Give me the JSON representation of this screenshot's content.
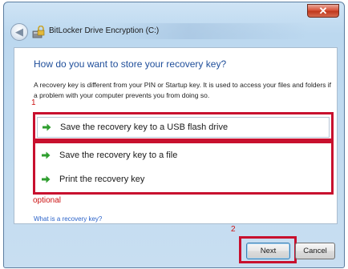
{
  "window": {
    "title": "BitLocker Drive Encryption (C:)",
    "close_glyph": "✕",
    "back_glyph": "◀"
  },
  "page": {
    "heading": "How do you want to store your recovery key?",
    "description": "A recovery key is different from your PIN or Startup key. It is used to access your files and folders if a problem with your computer prevents you from doing so."
  },
  "options": [
    {
      "icon": "green-arrow-icon",
      "label": "Save the recovery key to a USB flash drive"
    },
    {
      "icon": "green-arrow-icon",
      "label": "Save the recovery key to a file"
    },
    {
      "icon": "green-arrow-icon",
      "label": "Print the recovery key"
    }
  ],
  "help_link": "What is a recovery key?",
  "annotations": {
    "marker_1": "1",
    "marker_2": "2",
    "optional_label": "optional",
    "color": "#c8102e"
  },
  "buttons": {
    "next": "Next",
    "cancel": "Cancel"
  },
  "colors": {
    "heading": "#1f4e9a",
    "link": "#2a62c9",
    "arrow": "#2e9e2e"
  }
}
